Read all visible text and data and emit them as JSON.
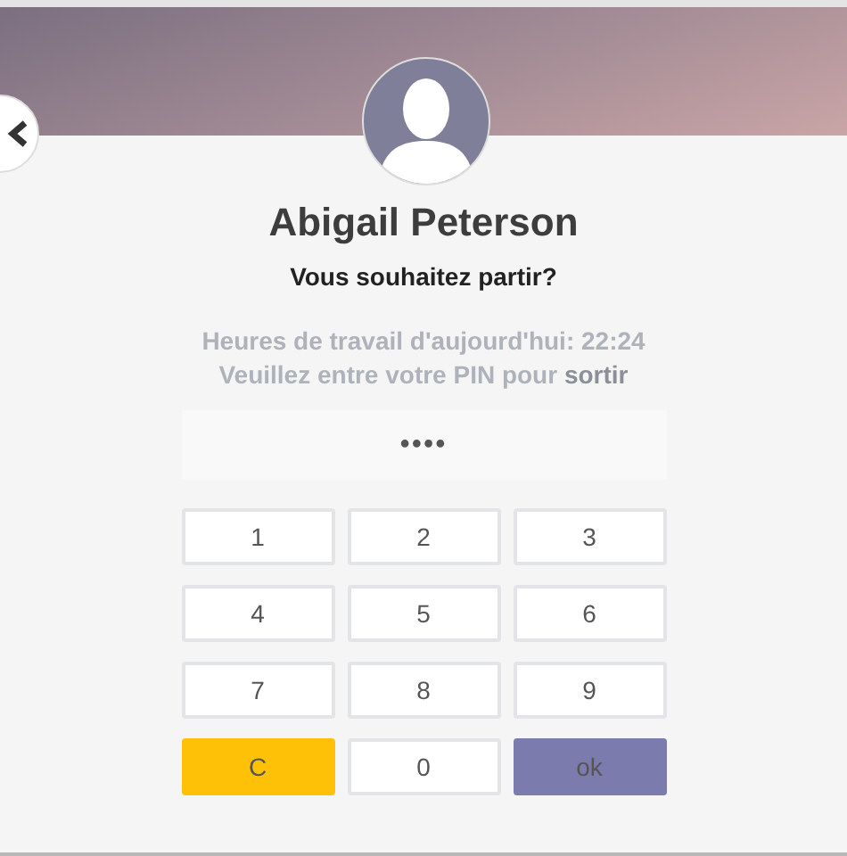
{
  "employee": {
    "name": "Abigail Peterson",
    "question": "Vous souhaitez partir?"
  },
  "info": {
    "hours": "Heures de travail d'aujourd'hui: 22:24",
    "instruction": "Veuillez entre votre PIN pour **sortir**"
  },
  "pin": {
    "value": "••••"
  },
  "keypad": [
    {
      "label": "1",
      "kind": "digit"
    },
    {
      "label": "2",
      "kind": "digit"
    },
    {
      "label": "3",
      "kind": "digit"
    },
    {
      "label": "4",
      "kind": "digit"
    },
    {
      "label": "5",
      "kind": "digit"
    },
    {
      "label": "6",
      "kind": "digit"
    },
    {
      "label": "7",
      "kind": "digit"
    },
    {
      "label": "8",
      "kind": "digit"
    },
    {
      "label": "9",
      "kind": "digit"
    },
    {
      "label": "C",
      "kind": "clear"
    },
    {
      "label": "0",
      "kind": "digit"
    },
    {
      "label": "ok",
      "kind": "ok"
    }
  ]
}
